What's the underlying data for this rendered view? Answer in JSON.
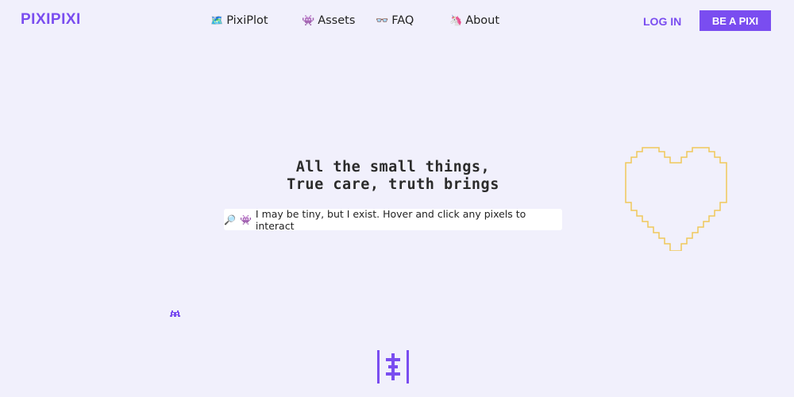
{
  "brand": {
    "logo": "PIXIPIXI",
    "accent": "#7a4df0",
    "heart_color": "#f0c75a"
  },
  "nav": {
    "items": [
      {
        "icon": "map-icon",
        "glyph": "🗺️",
        "label": "PixiPlot"
      },
      {
        "icon": "pixel-bug-icon",
        "glyph": "👾",
        "label": "Assets"
      },
      {
        "icon": "glasses-icon",
        "glyph": "👓",
        "label": "FAQ"
      },
      {
        "icon": "unicorn-icon",
        "glyph": "🦄",
        "label": "About"
      }
    ],
    "login": "LOG IN",
    "cta": "BE A PIXI"
  },
  "hero": {
    "line1": "All the small things,",
    "line2": "True care, truth brings",
    "hint_glyph1": "🔎",
    "hint_glyph2": "👾",
    "hint": "I may be tiny, but I exist. Hover and click any pixels to interact"
  },
  "decor": {
    "heart": "heart-icon",
    "bug": "pixel-bug-icon",
    "scroll": "text-cursor-icon"
  }
}
